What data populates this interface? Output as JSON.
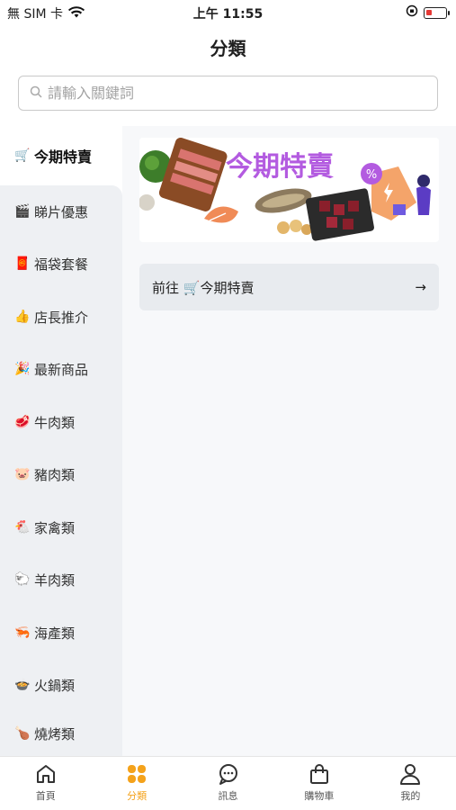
{
  "status_bar": {
    "carrier": "無 SIM 卡",
    "time": "上午 11:55",
    "battery_level": 0.3,
    "battery_color": "#e53935"
  },
  "header": {
    "title": "分類"
  },
  "search": {
    "placeholder": "請輸入關鍵詞"
  },
  "sidebar": {
    "items": [
      {
        "emoji": "🛒",
        "label": "今期特賣",
        "active": true
      },
      {
        "emoji": "🎬",
        "label": "睇片優惠"
      },
      {
        "emoji": "🧧",
        "label": "福袋套餐"
      },
      {
        "emoji": "👍",
        "label": "店長推介"
      },
      {
        "emoji": "🎉",
        "label": "最新商品"
      },
      {
        "emoji": "🥩",
        "label": "牛肉類"
      },
      {
        "emoji": "🐷",
        "label": "豬肉類"
      },
      {
        "emoji": "🐔",
        "label": "家禽類"
      },
      {
        "emoji": "🐑",
        "label": "羊肉類"
      },
      {
        "emoji": "🦐",
        "label": "海產類"
      },
      {
        "emoji": "🍲",
        "label": "火鍋類"
      },
      {
        "emoji": "🍗",
        "label": "燒烤類"
      }
    ]
  },
  "main": {
    "banner": {
      "title": "今期特賣",
      "badge": "%"
    },
    "goto_button": {
      "prefix": "前往",
      "emoji": "🛒",
      "label": "今期特賣",
      "arrow": "→"
    }
  },
  "tabbar": {
    "tabs": [
      {
        "label": "首頁",
        "icon": "home-icon"
      },
      {
        "label": "分類",
        "icon": "category-icon",
        "active": true
      },
      {
        "label": "訊息",
        "icon": "message-icon"
      },
      {
        "label": "購物車",
        "icon": "cart-icon"
      },
      {
        "label": "我的",
        "icon": "profile-icon"
      }
    ],
    "accent": "#f4a21b"
  }
}
